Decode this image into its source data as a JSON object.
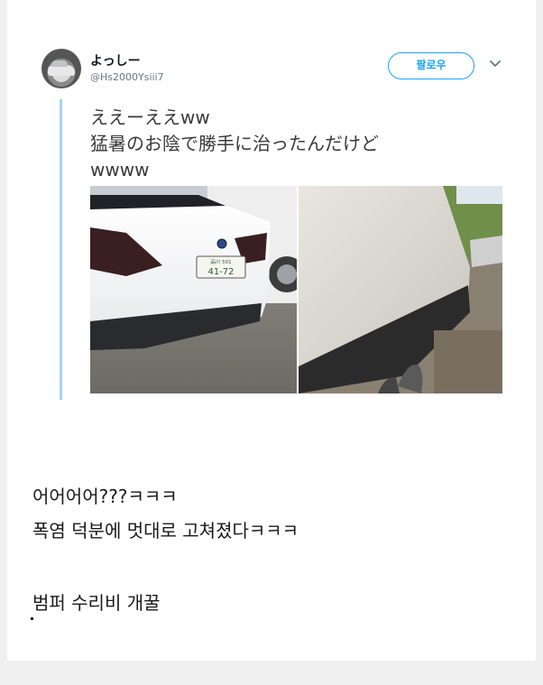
{
  "tweet": {
    "author_name": "よっしー",
    "author_handle": "@Hs2000Ysiii7",
    "follow_label": "팔로우",
    "text_lines": [
      "ええーええww",
      "猛暑のお陰で勝手に治ったんだけど",
      "wwww"
    ],
    "photo_left_plate_region": "品川 501",
    "photo_left_plate_number": "41-72"
  },
  "caption": {
    "line1": "어어어어???ㅋㅋㅋ",
    "line2": "폭염 덕분에 멋대로 고쳐졌다ㅋㅋㅋ",
    "line3": "범퍼 수리비 개꿀"
  },
  "colors": {
    "accent": "#1da1f2",
    "rail": "#a3d4f5"
  }
}
